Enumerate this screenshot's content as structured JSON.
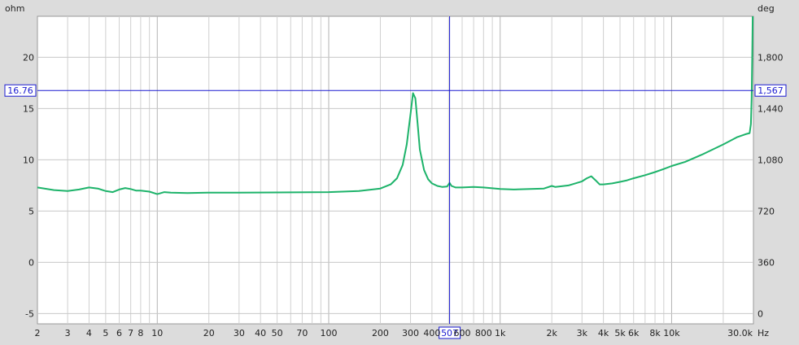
{
  "chart_data": {
    "type": "line",
    "title": "",
    "left_axis": {
      "unit_label": "ohm",
      "ticks": [
        -5,
        0,
        5,
        10,
        15,
        20
      ],
      "tick_labels": [
        "-5",
        "0",
        "5",
        "10",
        "15",
        "20"
      ],
      "range": [
        -6.0,
        24.0
      ]
    },
    "right_axis": {
      "unit_label": "deg",
      "ticks": [
        0,
        360,
        720,
        1080,
        1440,
        1800
      ],
      "tick_labels": [
        "0",
        "360",
        "720",
        "1,080",
        "1,440",
        "1,800"
      ]
    },
    "x_axis": {
      "scale": "log",
      "unit_label": "Hz",
      "range": [
        2,
        30000
      ],
      "labeled_ticks": [
        2,
        3,
        4,
        5,
        6,
        7,
        8,
        10,
        20,
        30,
        40,
        50,
        70,
        100,
        200,
        300,
        400,
        600,
        800,
        1000,
        2000,
        3000,
        4000,
        5000,
        6000,
        8000,
        10000,
        30000
      ],
      "tick_labels": [
        "2",
        "3",
        "4",
        "5",
        "6",
        "7",
        "8",
        "10",
        "20",
        "30",
        "40",
        "50",
        "70",
        "100",
        "200",
        "300",
        "400",
        "600",
        "800",
        "1k",
        "2k",
        "3k",
        "4k",
        "5k",
        "6k",
        "8k",
        "10k",
        "30.0k"
      ]
    },
    "grid": true,
    "cursor": {
      "x_value": 507,
      "x_label": "507",
      "y_value": 16.76,
      "y_label_left": "16.76",
      "y_label_right": "1,567"
    },
    "series": [
      {
        "color": "#1db36a",
        "x": [
          2,
          2.5,
          3,
          3.5,
          4,
          4.5,
          5,
          5.5,
          6,
          6.5,
          7,
          7.5,
          8,
          9,
          10,
          11,
          12,
          15,
          20,
          30,
          50,
          100,
          150,
          200,
          230,
          250,
          270,
          285,
          300,
          310,
          320,
          330,
          340,
          360,
          380,
          400,
          430,
          460,
          490,
          507,
          520,
          550,
          600,
          700,
          800,
          1000,
          1200,
          1500,
          1800,
          2000,
          2100,
          2200,
          2500,
          3000,
          3200,
          3400,
          3600,
          3800,
          4000,
          4500,
          5000,
          5500,
          6000,
          7000,
          8000,
          9000,
          10000,
          12000,
          15000,
          20000,
          24000,
          27000,
          28500,
          29000,
          29300,
          29500,
          29700
        ],
        "values": [
          7.3,
          7.05,
          6.95,
          7.1,
          7.3,
          7.2,
          6.95,
          6.85,
          7.1,
          7.25,
          7.15,
          7.0,
          7.0,
          6.9,
          6.65,
          6.85,
          6.8,
          6.75,
          6.8,
          6.8,
          6.82,
          6.85,
          6.95,
          7.2,
          7.6,
          8.2,
          9.5,
          11.5,
          14.5,
          16.5,
          16.0,
          13.5,
          11.0,
          9.0,
          8.1,
          7.7,
          7.45,
          7.35,
          7.4,
          7.75,
          7.45,
          7.3,
          7.3,
          7.35,
          7.3,
          7.15,
          7.1,
          7.15,
          7.2,
          7.45,
          7.35,
          7.4,
          7.5,
          7.9,
          8.2,
          8.4,
          8.0,
          7.6,
          7.6,
          7.7,
          7.85,
          8.0,
          8.2,
          8.5,
          8.8,
          9.1,
          9.4,
          9.8,
          10.5,
          11.5,
          12.2,
          12.5,
          12.6,
          13.5,
          16.0,
          20.0,
          24.0
        ]
      }
    ]
  }
}
